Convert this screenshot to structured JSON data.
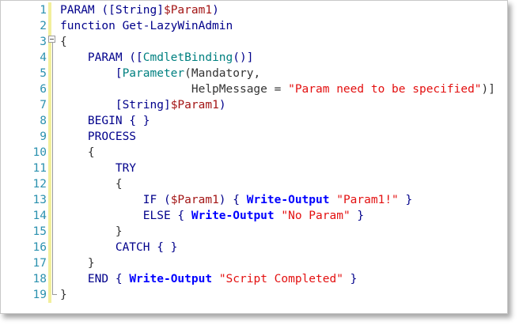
{
  "editor": {
    "lines": [
      {
        "num": "1",
        "segments": [
          {
            "t": "PARAM ([",
            "c": "kw"
          },
          {
            "t": "String",
            "c": "kw"
          },
          {
            "t": "]",
            "c": "kw"
          },
          {
            "t": "$Param1",
            "c": "vr"
          },
          {
            "t": ")",
            "c": "kw"
          }
        ]
      },
      {
        "num": "2",
        "segments": [
          {
            "t": "function Get-LazyWinAdmin",
            "c": "kw"
          }
        ]
      },
      {
        "num": "3",
        "segments": [
          {
            "t": "{",
            "c": "op"
          }
        ]
      },
      {
        "num": "4",
        "segments": [
          {
            "t": "    PARAM ([",
            "c": "kw"
          },
          {
            "t": "CmdletBinding",
            "c": "ty"
          },
          {
            "t": "()]",
            "c": "kw"
          }
        ]
      },
      {
        "num": "5",
        "segments": [
          {
            "t": "        [",
            "c": "kw"
          },
          {
            "t": "Parameter",
            "c": "ty"
          },
          {
            "t": "(Mandatory,",
            "c": "op"
          }
        ]
      },
      {
        "num": "6",
        "segments": [
          {
            "t": "                   HelpMessage ",
            "c": "op"
          },
          {
            "t": "=",
            "c": "op"
          },
          {
            "t": " ",
            "c": "op"
          },
          {
            "t": "\"Param need to be specified\"",
            "c": "st"
          },
          {
            "t": ")]",
            "c": "op"
          }
        ]
      },
      {
        "num": "7",
        "segments": [
          {
            "t": "        [",
            "c": "kw"
          },
          {
            "t": "String",
            "c": "kw"
          },
          {
            "t": "]",
            "c": "kw"
          },
          {
            "t": "$Param1",
            "c": "vr"
          },
          {
            "t": ")",
            "c": "kw"
          }
        ]
      },
      {
        "num": "8",
        "segments": [
          {
            "t": "    BEGIN { }",
            "c": "kw"
          }
        ]
      },
      {
        "num": "9",
        "segments": [
          {
            "t": "    PROCESS",
            "c": "kw"
          }
        ]
      },
      {
        "num": "10",
        "segments": [
          {
            "t": "    {",
            "c": "op"
          }
        ]
      },
      {
        "num": "11",
        "segments": [
          {
            "t": "        TRY",
            "c": "kw"
          }
        ]
      },
      {
        "num": "12",
        "segments": [
          {
            "t": "        {",
            "c": "op"
          }
        ]
      },
      {
        "num": "13",
        "segments": [
          {
            "t": "            IF (",
            "c": "kw"
          },
          {
            "t": "$Param1",
            "c": "vr"
          },
          {
            "t": ") { ",
            "c": "kw"
          },
          {
            "t": "Write-Output",
            "c": "cm"
          },
          {
            "t": " ",
            "c": "op"
          },
          {
            "t": "\"Param1!\"",
            "c": "st"
          },
          {
            "t": " }",
            "c": "kw"
          }
        ]
      },
      {
        "num": "14",
        "segments": [
          {
            "t": "            ELSE { ",
            "c": "kw"
          },
          {
            "t": "Write-Output",
            "c": "cm"
          },
          {
            "t": " ",
            "c": "op"
          },
          {
            "t": "\"No Param\"",
            "c": "st"
          },
          {
            "t": " }",
            "c": "kw"
          }
        ]
      },
      {
        "num": "15",
        "segments": [
          {
            "t": "        }",
            "c": "op"
          }
        ]
      },
      {
        "num": "16",
        "segments": [
          {
            "t": "        CATCH { }",
            "c": "kw"
          }
        ]
      },
      {
        "num": "17",
        "segments": [
          {
            "t": "    }",
            "c": "op"
          }
        ]
      },
      {
        "num": "18",
        "segments": [
          {
            "t": "    END { ",
            "c": "kw"
          },
          {
            "t": "Write-Output",
            "c": "cm"
          },
          {
            "t": " ",
            "c": "op"
          },
          {
            "t": "\"Script Completed\"",
            "c": "st"
          },
          {
            "t": " }",
            "c": "kw"
          }
        ]
      },
      {
        "num": "19",
        "segments": [
          {
            "t": "}",
            "c": "op"
          }
        ]
      }
    ],
    "colors": {
      "line_number": "#2b91af",
      "keyword": "#00008b",
      "type": "#008080",
      "variable": "#a31515",
      "cmdlet": "#0000ff",
      "string": "#e31010",
      "change_bar": "#f2ef9c"
    },
    "icons": {
      "fold_marker": "collapse-minus-icon"
    }
  }
}
